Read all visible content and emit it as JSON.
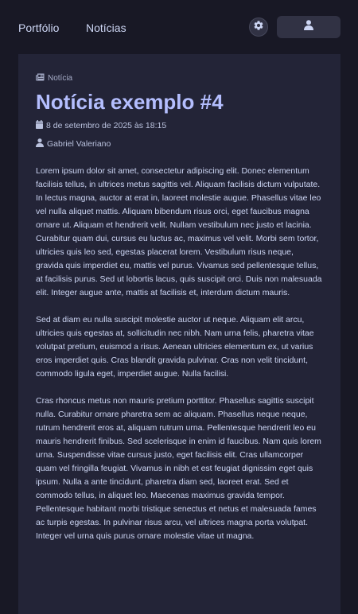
{
  "nav": {
    "links": [
      "Portfólio",
      "Notícias"
    ]
  },
  "icons": {
    "theme": "gear-icon",
    "user": "user-icon",
    "category": "newspaper-icon",
    "date": "calendar-icon",
    "author": "user-icon"
  },
  "colors": {
    "background": "#181825",
    "card": "#232437",
    "title": "#b4befe",
    "text": "#cdd6f4"
  },
  "article": {
    "category": "Notícia",
    "title": "Notícia exemplo #4",
    "date": "8 de setembro de 2025 às 18:15",
    "author": "Gabriel Valeriano",
    "paragraphs": [
      "Lorem ipsum dolor sit amet, consectetur adipiscing elit. Donec elementum facilisis tellus, in ultrices metus sagittis vel. Aliquam facilisis dictum vulputate. In lectus magna, auctor at erat in, laoreet molestie augue. Phasellus vitae leo vel nulla aliquet mattis. Aliquam bibendum risus orci, eget faucibus magna ornare ut. Aliquam et hendrerit velit. Nullam vestibulum nec justo et lacinia. Curabitur quam dui, cursus eu luctus ac, maximus vel velit. Morbi sem tortor, ultricies quis leo sed, egestas placerat lorem. Vestibulum risus neque, gravida quis imperdiet eu, mattis vel purus. Vivamus sed pellentesque tellus, at facilisis purus. Sed ut lobortis lacus, quis suscipit orci. Duis non malesuada elit. Integer augue ante, mattis at facilisis et, interdum dictum mauris.",
      "Sed at diam eu nulla suscipit molestie auctor ut neque. Aliquam elit arcu, ultricies quis egestas at, sollicitudin nec nibh. Nam urna felis, pharetra vitae volutpat pretium, euismod a risus. Aenean ultricies elementum ex, ut varius eros imperdiet quis. Cras blandit gravida pulvinar. Cras non velit tincidunt, commodo ligula eget, imperdiet augue. Nulla facilisi.",
      "Cras rhoncus metus non mauris pretium porttitor. Phasellus sagittis suscipit nulla. Curabitur ornare pharetra sem ac aliquam. Phasellus neque neque, rutrum hendrerit eros at, aliquam rutrum urna. Pellentesque hendrerit leo eu mauris hendrerit finibus. Sed scelerisque in enim id faucibus. Nam quis lorem urna. Suspendisse vitae cursus justo, eget facilisis elit. Cras ullamcorper quam vel fringilla feugiat. Vivamus in nibh et est feugiat dignissim eget quis ipsum. Nulla a ante tincidunt, pharetra diam sed, laoreet erat. Sed et commodo tellus, in aliquet leo. Maecenas maximus gravida tempor. Pellentesque habitant morbi tristique senectus et netus et malesuada fames ac turpis egestas. In pulvinar risus arcu, vel ultrices magna porta volutpat. Integer vel urna quis purus ornare molestie vitae ut magna."
    ]
  }
}
